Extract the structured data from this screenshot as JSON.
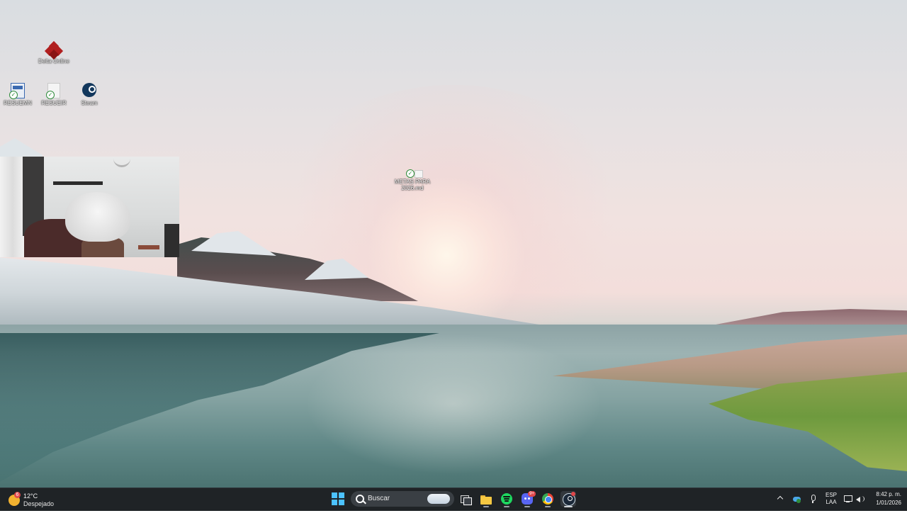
{
  "desktop": {
    "icons": [
      {
        "label": "Delta Online"
      },
      {
        "label": "RESUEMN"
      },
      {
        "label": "RESUEIR"
      },
      {
        "label": "Steam"
      },
      {
        "label_line1": "METAS PARA",
        "label_line2": "2026.md"
      }
    ]
  },
  "webcam": {},
  "taskbar": {
    "weather": {
      "temperature": "12°C",
      "condition": "Despejado",
      "badge": "6"
    },
    "search": {
      "placeholder": "Buscar"
    },
    "apps": [
      {
        "name": "task-view-icon"
      },
      {
        "name": "file-explorer-icon"
      },
      {
        "name": "spotify-icon"
      },
      {
        "name": "discord-icon",
        "badge": "9+"
      },
      {
        "name": "chrome-icon"
      },
      {
        "name": "steam-app-icon"
      }
    ],
    "tray": {
      "language_line1": "ESP",
      "language_line2": "LAA",
      "time": "8:42 p. m.",
      "date": "1/01/2026"
    }
  },
  "colors": {
    "taskbar_bg": "#1f2326",
    "accent": "#4cc2ff"
  }
}
